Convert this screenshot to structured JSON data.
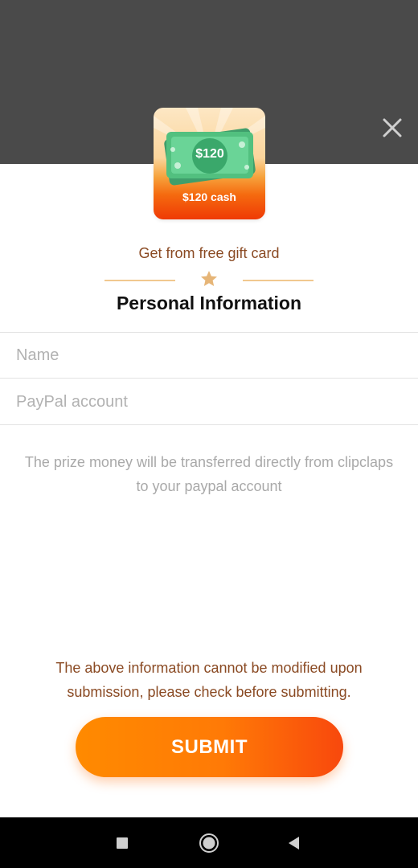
{
  "prize_card": {
    "bill_amount": "$120",
    "cash_label": "$120 cash"
  },
  "subtitle": "Get from free gift card",
  "title": "Personal Information",
  "form": {
    "name_placeholder": "Name",
    "name_value": "",
    "paypal_placeholder": "PayPal account",
    "paypal_value": ""
  },
  "note": "The prize money will be transferred directly from clipclaps to your paypal account",
  "warning": "The above information cannot be modified upon submission, please check before submitting.",
  "submit_label": "SUBMIT",
  "icons": {
    "close": "close-icon",
    "star": "star-icon",
    "recent": "recent-apps-icon",
    "home": "home-icon",
    "back": "back-icon"
  },
  "colors": {
    "brown_text": "#8a4a23",
    "accent_orange": "#ff7a06",
    "overlay": "#4a4a4a"
  }
}
